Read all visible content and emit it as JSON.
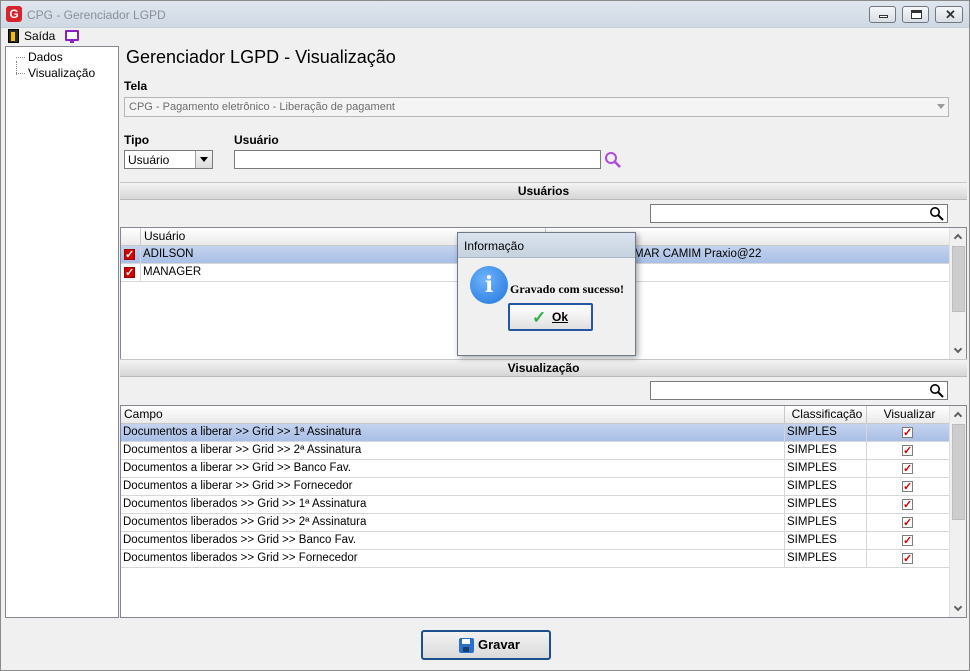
{
  "window": {
    "title": "CPG - Gerenciador LGPD",
    "app_icon": "G"
  },
  "menu": {
    "exit_label": "Saída"
  },
  "tree": {
    "items": [
      "Dados",
      "Visualização"
    ]
  },
  "main": {
    "title": "Gerenciador LGPD - Visualização",
    "tela_label": "Tela",
    "tela_value": "CPG - Pagamento eletrônico - Liberação de pagament",
    "tipo_label": "Tipo",
    "tipo_value": "Usuário",
    "usuario_label": "Usuário",
    "usuario_value": ""
  },
  "users_section": {
    "title": "Usuários",
    "search_value": "",
    "columns": [
      "Usuário"
    ],
    "rows": [
      {
        "checked": true,
        "name": "ADILSON",
        "extra": "MAR CAMIM Praxio@22",
        "selected": true
      },
      {
        "checked": true,
        "name": "MANAGER",
        "extra": "",
        "selected": false
      }
    ]
  },
  "view_section": {
    "title": "Visualização",
    "search_value": "",
    "columns": [
      "Campo",
      "Classificação",
      "Visualizar"
    ],
    "rows": [
      {
        "campo": "Documentos a liberar >> Grid >> 1ª Assinatura",
        "classificacao": "SIMPLES",
        "visualizar": true
      },
      {
        "campo": "Documentos a liberar >> Grid >> 2ª Assinatura",
        "classificacao": "SIMPLES",
        "visualizar": true
      },
      {
        "campo": "Documentos a liberar >> Grid >> Banco Fav.",
        "classificacao": "SIMPLES",
        "visualizar": true
      },
      {
        "campo": "Documentos a liberar >> Grid >> Fornecedor",
        "classificacao": "SIMPLES",
        "visualizar": true
      },
      {
        "campo": "Documentos liberados >> Grid >> 1ª Assinatura",
        "classificacao": "SIMPLES",
        "visualizar": true
      },
      {
        "campo": "Documentos liberados >> Grid >> 2ª Assinatura",
        "classificacao": "SIMPLES",
        "visualizar": true
      },
      {
        "campo": "Documentos liberados >> Grid >> Banco Fav.",
        "classificacao": "SIMPLES",
        "visualizar": true
      },
      {
        "campo": "Documentos liberados >> Grid >> Fornecedor",
        "classificacao": "SIMPLES",
        "visualizar": true
      }
    ]
  },
  "footer": {
    "save_label": "Gravar"
  },
  "dialog": {
    "title": "Informação",
    "message": "Gravado com sucesso!",
    "ok_label": "Ok",
    "icon": "info-icon"
  },
  "colors": {
    "selection": "#b6c8ea",
    "checkbox_red": "#d40000",
    "button_border": "#1c4f8c"
  }
}
